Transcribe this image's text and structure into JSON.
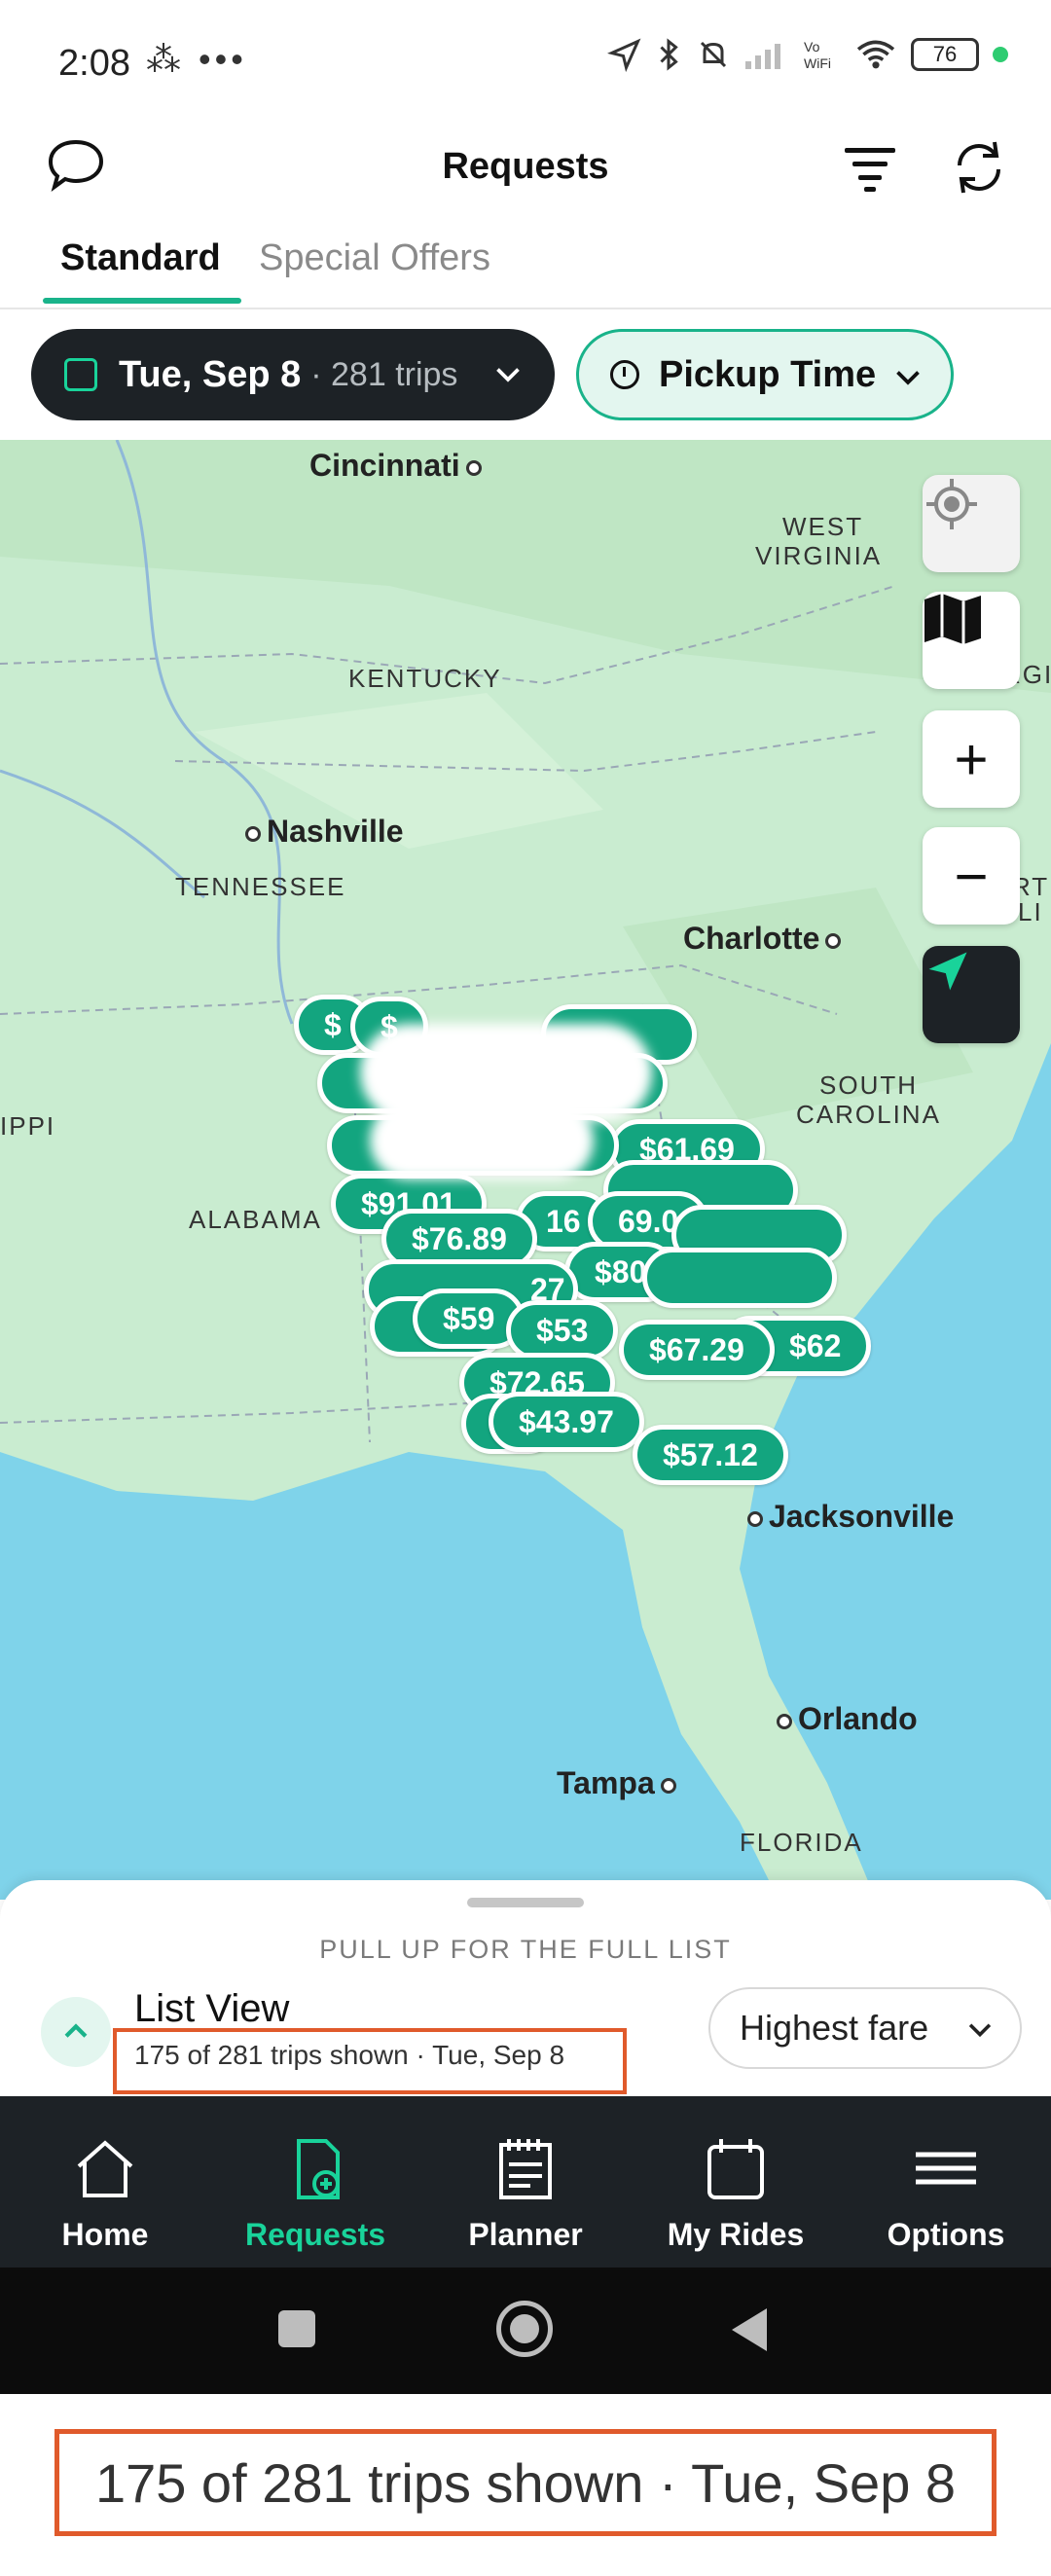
{
  "status_bar": {
    "time": "2:08",
    "left_icons": "⁂ •••",
    "battery": "76"
  },
  "header": {
    "title": "Requests"
  },
  "tabs": [
    {
      "label": "Standard",
      "active": true
    },
    {
      "label": "Special Offers",
      "active": false
    }
  ],
  "filters": {
    "date_label": "Tue, Sep 8",
    "date_trips": "· 281 trips",
    "pickup_label": "Pickup Time"
  },
  "map": {
    "cities": {
      "cincinnati": "Cincinnati",
      "nashville": "Nashville",
      "charlotte": "Charlotte",
      "jacksonville": "Jacksonville",
      "orlando": "Orlando",
      "tampa": "Tampa"
    },
    "states": {
      "west_virginia_1": "WEST",
      "west_virginia_2": "VIRGINIA",
      "kentucky": "KENTUCKY",
      "tennessee": "TENNESSEE",
      "south_carolina_1": "SOUTH",
      "south_carolina_2": "CAROLINA",
      "alabama": "ALABAMA",
      "mississippi_partial": "IPPI",
      "florida": "FLORIDA",
      "virginia_partial": "RGI",
      "north_carolina_partial": "RTI",
      "nc_partial2": "LI"
    },
    "pins": [
      "$76.89",
      "$59",
      "$53",
      "$67.29",
      "$72.65",
      "$43.97",
      "$57.12",
      "$62",
      "$61.69",
      "$91.01",
      "16",
      "69.0",
      "$80",
      "$",
      "$",
      "27"
    ],
    "colors": {
      "pin": "#13a57f",
      "land": "#c9ecd0",
      "water": "#7fd3ea"
    }
  },
  "sheet": {
    "pull_hint": "PULL UP FOR THE FULL LIST",
    "list_title": "List View",
    "list_sub": "175 of 281 trips shown · Tue, Sep 8",
    "sort_label": "Highest fare"
  },
  "nav": [
    {
      "label": "Home",
      "icon": "home-icon",
      "active": false
    },
    {
      "label": "Requests",
      "icon": "requests-icon",
      "active": true
    },
    {
      "label": "Planner",
      "icon": "planner-icon",
      "active": false
    },
    {
      "label": "My Rides",
      "icon": "calendar-icon",
      "active": false
    },
    {
      "label": "Options",
      "icon": "menu-icon",
      "active": false
    }
  ],
  "caption": "175 of 281 trips shown · Tue, Sep 8",
  "accent": "#19b38a"
}
